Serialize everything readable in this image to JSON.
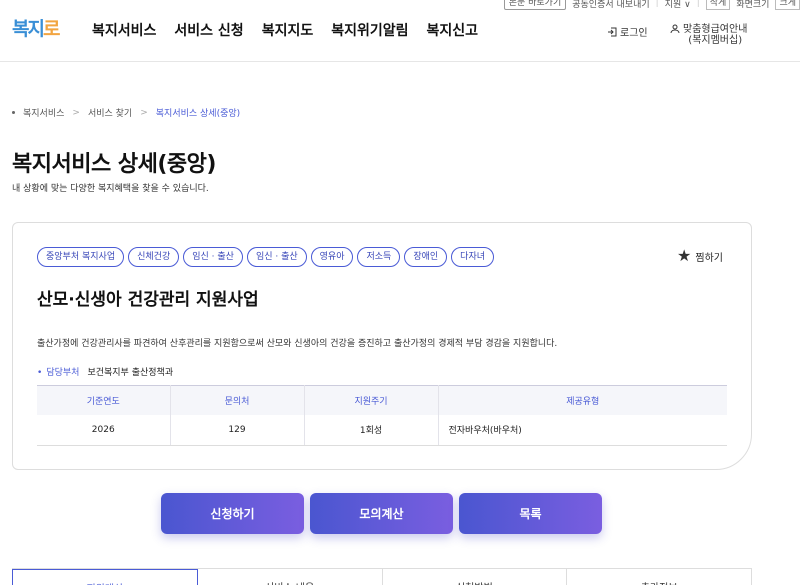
{
  "util": {
    "shortcut": "본문 바로가기",
    "cert": "공동인증서 내보내기",
    "lang": "지원 ∨",
    "small": "작게",
    "zoom": "화면크기",
    "large": "크게"
  },
  "header": {
    "logo_a": "복지",
    "logo_b": "로",
    "nav": [
      "복지서비스",
      "서비스 신청",
      "복지지도",
      "복지위기알림",
      "복지신고"
    ],
    "login": "로그인",
    "custom_line1": "맞춤형급여안내",
    "custom_line2": "(복지멤버십)"
  },
  "breadcrumb": [
    "복지서비스",
    "서비스 찾기",
    "복지서비스 상세(중앙)"
  ],
  "page": {
    "title": "복지서비스 상세(중앙)",
    "subtitle": "내 상황에 맞는 다양한 복지혜택을 찾을 수 있습니다."
  },
  "card": {
    "tags": [
      "중앙부처 복지사업",
      "신체건강",
      "임신 · 출산",
      "임신 · 출산",
      "영유아",
      "저소득",
      "장애인",
      "다자녀"
    ],
    "fav": "찜하기",
    "title": "산모·신생아 건강관리 지원사업",
    "desc": "출산가정에 건강관리사를 파견하여 산후관리를 지원함으로써 산모와 신생아의 건강을 증진하고 출산가정의 경제적 부담 경감을 지원합니다.",
    "dept_label": "담당부처",
    "dept_value": "보건복지부 출산정책과",
    "table": {
      "headers": [
        "기준연도",
        "문의처",
        "지원주기",
        "제공유형"
      ],
      "row": [
        "2026",
        "129",
        "1회성",
        "전자바우처(바우처)"
      ]
    }
  },
  "buttons": [
    "신청하기",
    "모의계산",
    "목록"
  ],
  "tabs": [
    "지원대상",
    "서비스 내용",
    "신청방법",
    "추가정보"
  ]
}
